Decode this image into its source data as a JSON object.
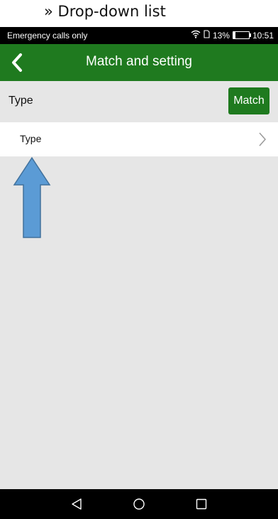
{
  "caption": {
    "text": "» Drop-down list"
  },
  "status_bar": {
    "carrier": "Emergency calls only",
    "battery_percent": "13%",
    "time": "10:51",
    "battery_level": 0.13
  },
  "header": {
    "title": "Match and setting"
  },
  "type_row": {
    "label": "Type",
    "match_button": "Match"
  },
  "dropdown": {
    "value": "Type"
  },
  "icons": {
    "back": "back-arrow-icon",
    "chevron": "chevron-right-icon",
    "wifi": "wifi-icon",
    "sim": "sim-icon",
    "battery": "battery-icon",
    "nav_back": "triangle-back-icon",
    "nav_home": "circle-home-icon",
    "nav_recent": "square-recent-icon",
    "annotation": "up-arrow-icon"
  },
  "colors": {
    "header_green": "#1f7a1f",
    "background": "#e6e6e6",
    "annotation_blue": "#5b9bd5"
  }
}
